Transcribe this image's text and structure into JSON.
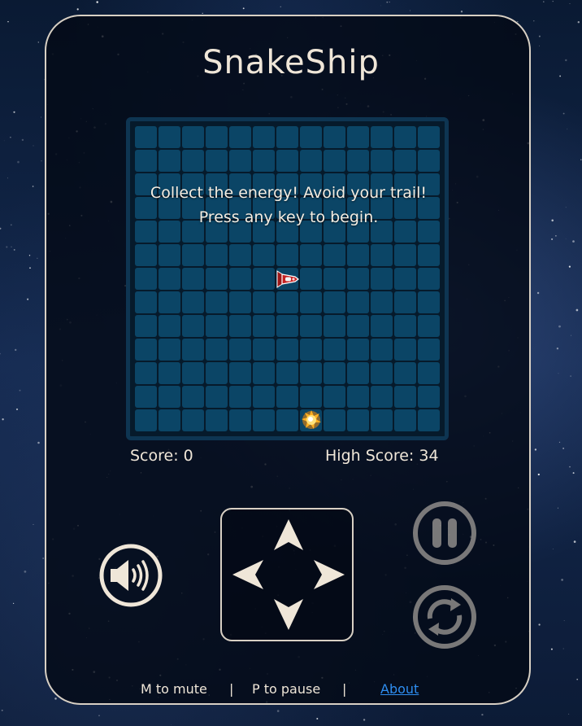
{
  "app": {
    "title": "SnakeShip"
  },
  "board": {
    "rows": 13,
    "cols": 13,
    "message_line1": "Collect the energy! Avoid your trail!",
    "message_line2": "Press any key to begin.",
    "ship_icon": "spaceship-icon",
    "energy_icon": "energy-orb-icon"
  },
  "scores": {
    "score_label": "Score: 0",
    "high_score_label": "High Score: 34"
  },
  "controls": {
    "mute_icon": "speaker-icon",
    "pause_icon": "pause-icon",
    "restart_icon": "restart-icon",
    "dpad_icons": [
      "arrow-up-icon",
      "arrow-left-icon",
      "arrow-right-icon",
      "arrow-down-icon"
    ]
  },
  "footer": {
    "mute_hint": "M to mute",
    "separator": "|",
    "pause_hint": "P to pause",
    "about_link": "About"
  },
  "colors": {
    "panel_border": "#d8d0c4",
    "text": "#efe6d8",
    "cell": "#0b4566",
    "board_border": "#0e3552",
    "link": "#2e8df0"
  }
}
